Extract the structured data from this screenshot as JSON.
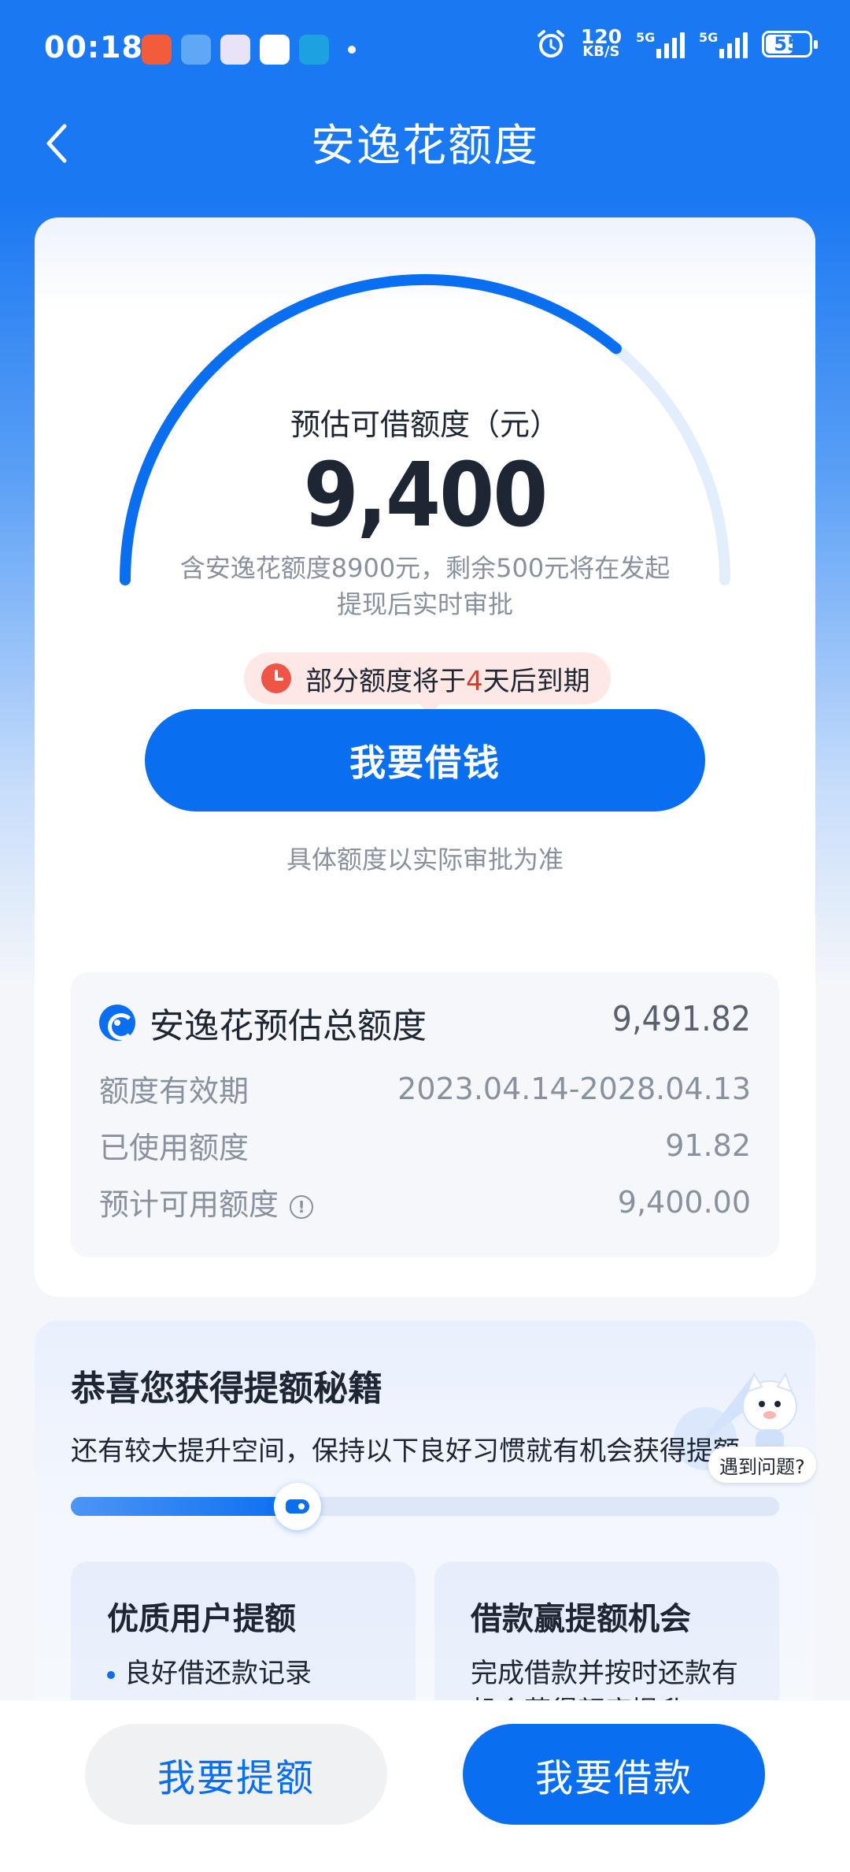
{
  "status_bar": {
    "time": "00:18",
    "speed_value": "120",
    "speed_unit": "KB/S",
    "signal1_label": "5G",
    "signal2_label": "5G",
    "battery": "55"
  },
  "header": {
    "title": "安逸花额度"
  },
  "main": {
    "gauge_fraction": 0.72,
    "est_label": "预估可借额度（元）",
    "est_value": "9,400",
    "est_desc": "含安逸花额度8900元，剩余500元将在发起提现后实时审批",
    "expire_prefix": "部分额度将于",
    "expire_days": "4",
    "expire_suffix": "天后到期",
    "borrow_button": "我要借钱",
    "approval_note": "具体额度以实际审批为准"
  },
  "quota": {
    "title": "安逸花预估总额度",
    "total": "9,491.82",
    "rows": [
      {
        "label": "额度有效期",
        "value": "2023.04.14-2028.04.13"
      },
      {
        "label": "已使用额度",
        "value": "91.82"
      },
      {
        "label": "预计可用额度",
        "value": "9,400.00"
      }
    ]
  },
  "secret": {
    "title": "恭喜您获得提额秘籍",
    "desc": "还有较大提升空间，保持以下良好习惯就有机会获得提额",
    "progress": 0.32,
    "cards": [
      {
        "title": "优质用户提额",
        "desc": "良好借还款记录"
      },
      {
        "title": "借款赢提额机会",
        "desc": "完成借款并按时还款有机会获得额度提升"
      }
    ]
  },
  "help": {
    "label": "遇到问题?"
  },
  "bottom": {
    "raise_button": "我要提额",
    "loan_button": "我要借款"
  },
  "colors": {
    "brand": "#0a6ef0",
    "header_blue": "#1a78f2",
    "warning_red": "#e8322a"
  }
}
